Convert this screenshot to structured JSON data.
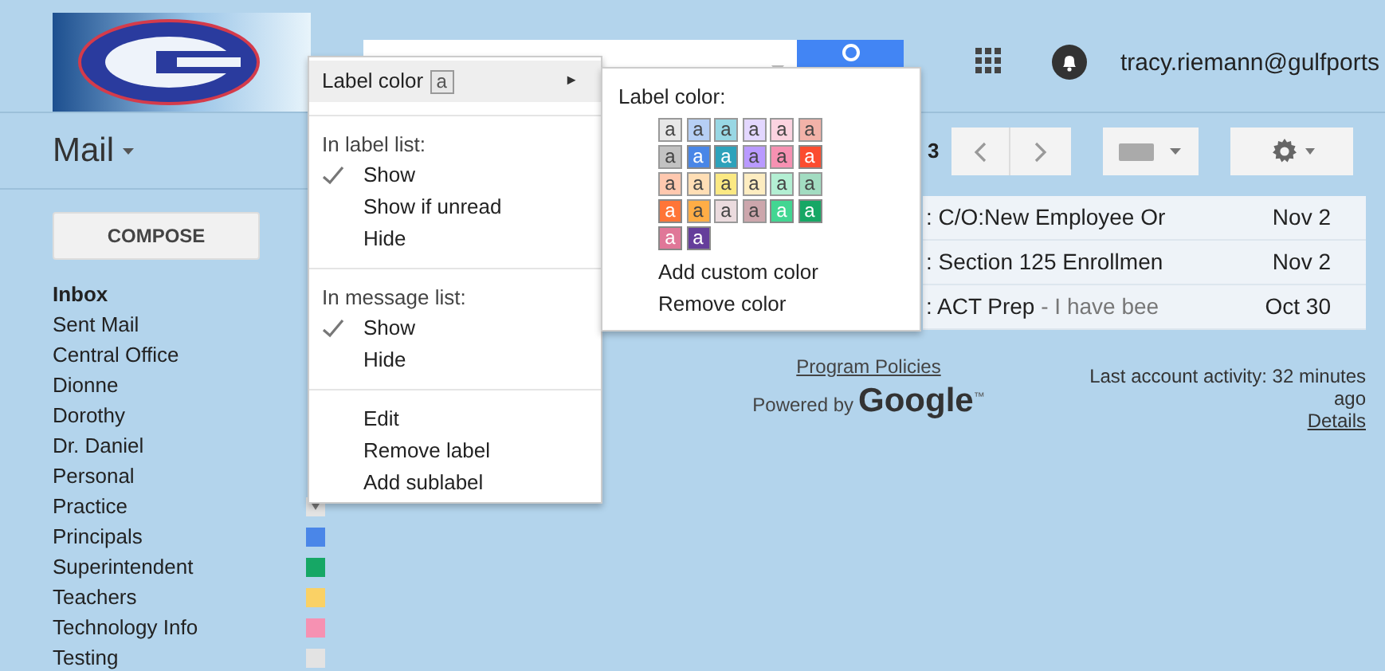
{
  "header": {
    "account": "tracy.riemann@gulfports"
  },
  "mail_menu": {
    "label": "Mail"
  },
  "compose": {
    "label": "COMPOSE"
  },
  "labels": [
    {
      "name": "Inbox",
      "selected": true
    },
    {
      "name": "Sent Mail",
      "selected": false
    },
    {
      "name": "Central Office",
      "selected": false
    },
    {
      "name": "Dionne",
      "selected": false
    },
    {
      "name": "Dorothy",
      "selected": false
    },
    {
      "name": "Dr. Daniel",
      "selected": false
    },
    {
      "name": "Personal",
      "selected": false
    },
    {
      "name": "Practice",
      "selected": false,
      "kind": "menu-handle"
    },
    {
      "name": "Principals",
      "selected": false,
      "kind": "colored",
      "color": "#4a86e8"
    },
    {
      "name": "Superintendent",
      "selected": false,
      "kind": "colored",
      "color": "#16a765"
    },
    {
      "name": "Teachers",
      "selected": false,
      "kind": "colored",
      "color": "#fad165"
    },
    {
      "name": "Technology Info",
      "selected": false,
      "kind": "colored",
      "color": "#f691b2"
    },
    {
      "name": "Testing",
      "selected": false,
      "kind": "colored",
      "color": "#e3e3e3"
    }
  ],
  "toolbar": {
    "page_count": "3"
  },
  "messages": [
    {
      "subject": ": C/O:New Employee Or",
      "date": "Nov 2"
    },
    {
      "subject": ": Section 125 Enrollmen",
      "date": "Nov 2"
    },
    {
      "subject": ": ACT Prep",
      "snippet": " - I have bee",
      "date": "Oct 30"
    }
  ],
  "footer": {
    "policies": "Program Policies",
    "powered_by": "Powered by",
    "brand": "Google",
    "trademark": "™",
    "activity": "Last account activity: 32 minutes ago",
    "details": "Details"
  },
  "context_menu": {
    "items": [
      {
        "kind": "submenu",
        "label": "Label color",
        "swatch": "a",
        "color": "#e7e7e7",
        "arrow": "►",
        "highlighted": true
      },
      {
        "kind": "separator"
      },
      {
        "kind": "heading",
        "label": "In label list:"
      },
      {
        "kind": "option",
        "label": "Show",
        "checked": true
      },
      {
        "kind": "option",
        "label": "Show if unread",
        "checked": false
      },
      {
        "kind": "option",
        "label": "Hide",
        "checked": false
      },
      {
        "kind": "separator"
      },
      {
        "kind": "heading",
        "label": "In message list:"
      },
      {
        "kind": "option",
        "label": "Show",
        "checked": true
      },
      {
        "kind": "option",
        "label": "Hide",
        "checked": false
      },
      {
        "kind": "separator"
      },
      {
        "kind": "action",
        "label": "Edit"
      },
      {
        "kind": "action",
        "label": "Remove label"
      },
      {
        "kind": "action",
        "label": "Add sublabel"
      }
    ]
  },
  "color_submenu": {
    "title": "Label color:",
    "swatches": [
      {
        "letter": "a",
        "color": "#e7e7e7"
      },
      {
        "letter": "a",
        "color": "#b6cff5"
      },
      {
        "letter": "a",
        "color": "#98d7e4"
      },
      {
        "letter": "a",
        "color": "#e3d7ff"
      },
      {
        "letter": "a",
        "color": "#fbd3e0"
      },
      {
        "letter": "a",
        "color": "#f2b2a8"
      },
      {
        "letter": "a",
        "color": "#c2c2c2"
      },
      {
        "letter": "a",
        "color": "#4986e7"
      },
      {
        "letter": "a",
        "color": "#2da2bb"
      },
      {
        "letter": "a",
        "color": "#b99aff"
      },
      {
        "letter": "a",
        "color": "#f691b2"
      },
      {
        "letter": "a",
        "color": "#fb4c2f"
      },
      {
        "letter": "a",
        "color": "#ffc8af"
      },
      {
        "letter": "a",
        "color": "#ffdeb5"
      },
      {
        "letter": "a",
        "color": "#fbe983"
      },
      {
        "letter": "a",
        "color": "#fdedc1"
      },
      {
        "letter": "a",
        "color": "#b3efd3"
      },
      {
        "letter": "a",
        "color": "#a2dcc1"
      },
      {
        "letter": "a",
        "color": "#ff7537"
      },
      {
        "letter": "a",
        "color": "#ffad46"
      },
      {
        "letter": "a",
        "color": "#ebdbde"
      },
      {
        "letter": "a",
        "color": "#cca6ac"
      },
      {
        "letter": "a",
        "color": "#42d692"
      },
      {
        "letter": "a",
        "color": "#16a765"
      },
      {
        "letter": "a",
        "color": "#e07798"
      },
      {
        "letter": "a",
        "color": "#653e9b"
      }
    ],
    "actions": [
      "Add custom color",
      "Remove color"
    ]
  }
}
